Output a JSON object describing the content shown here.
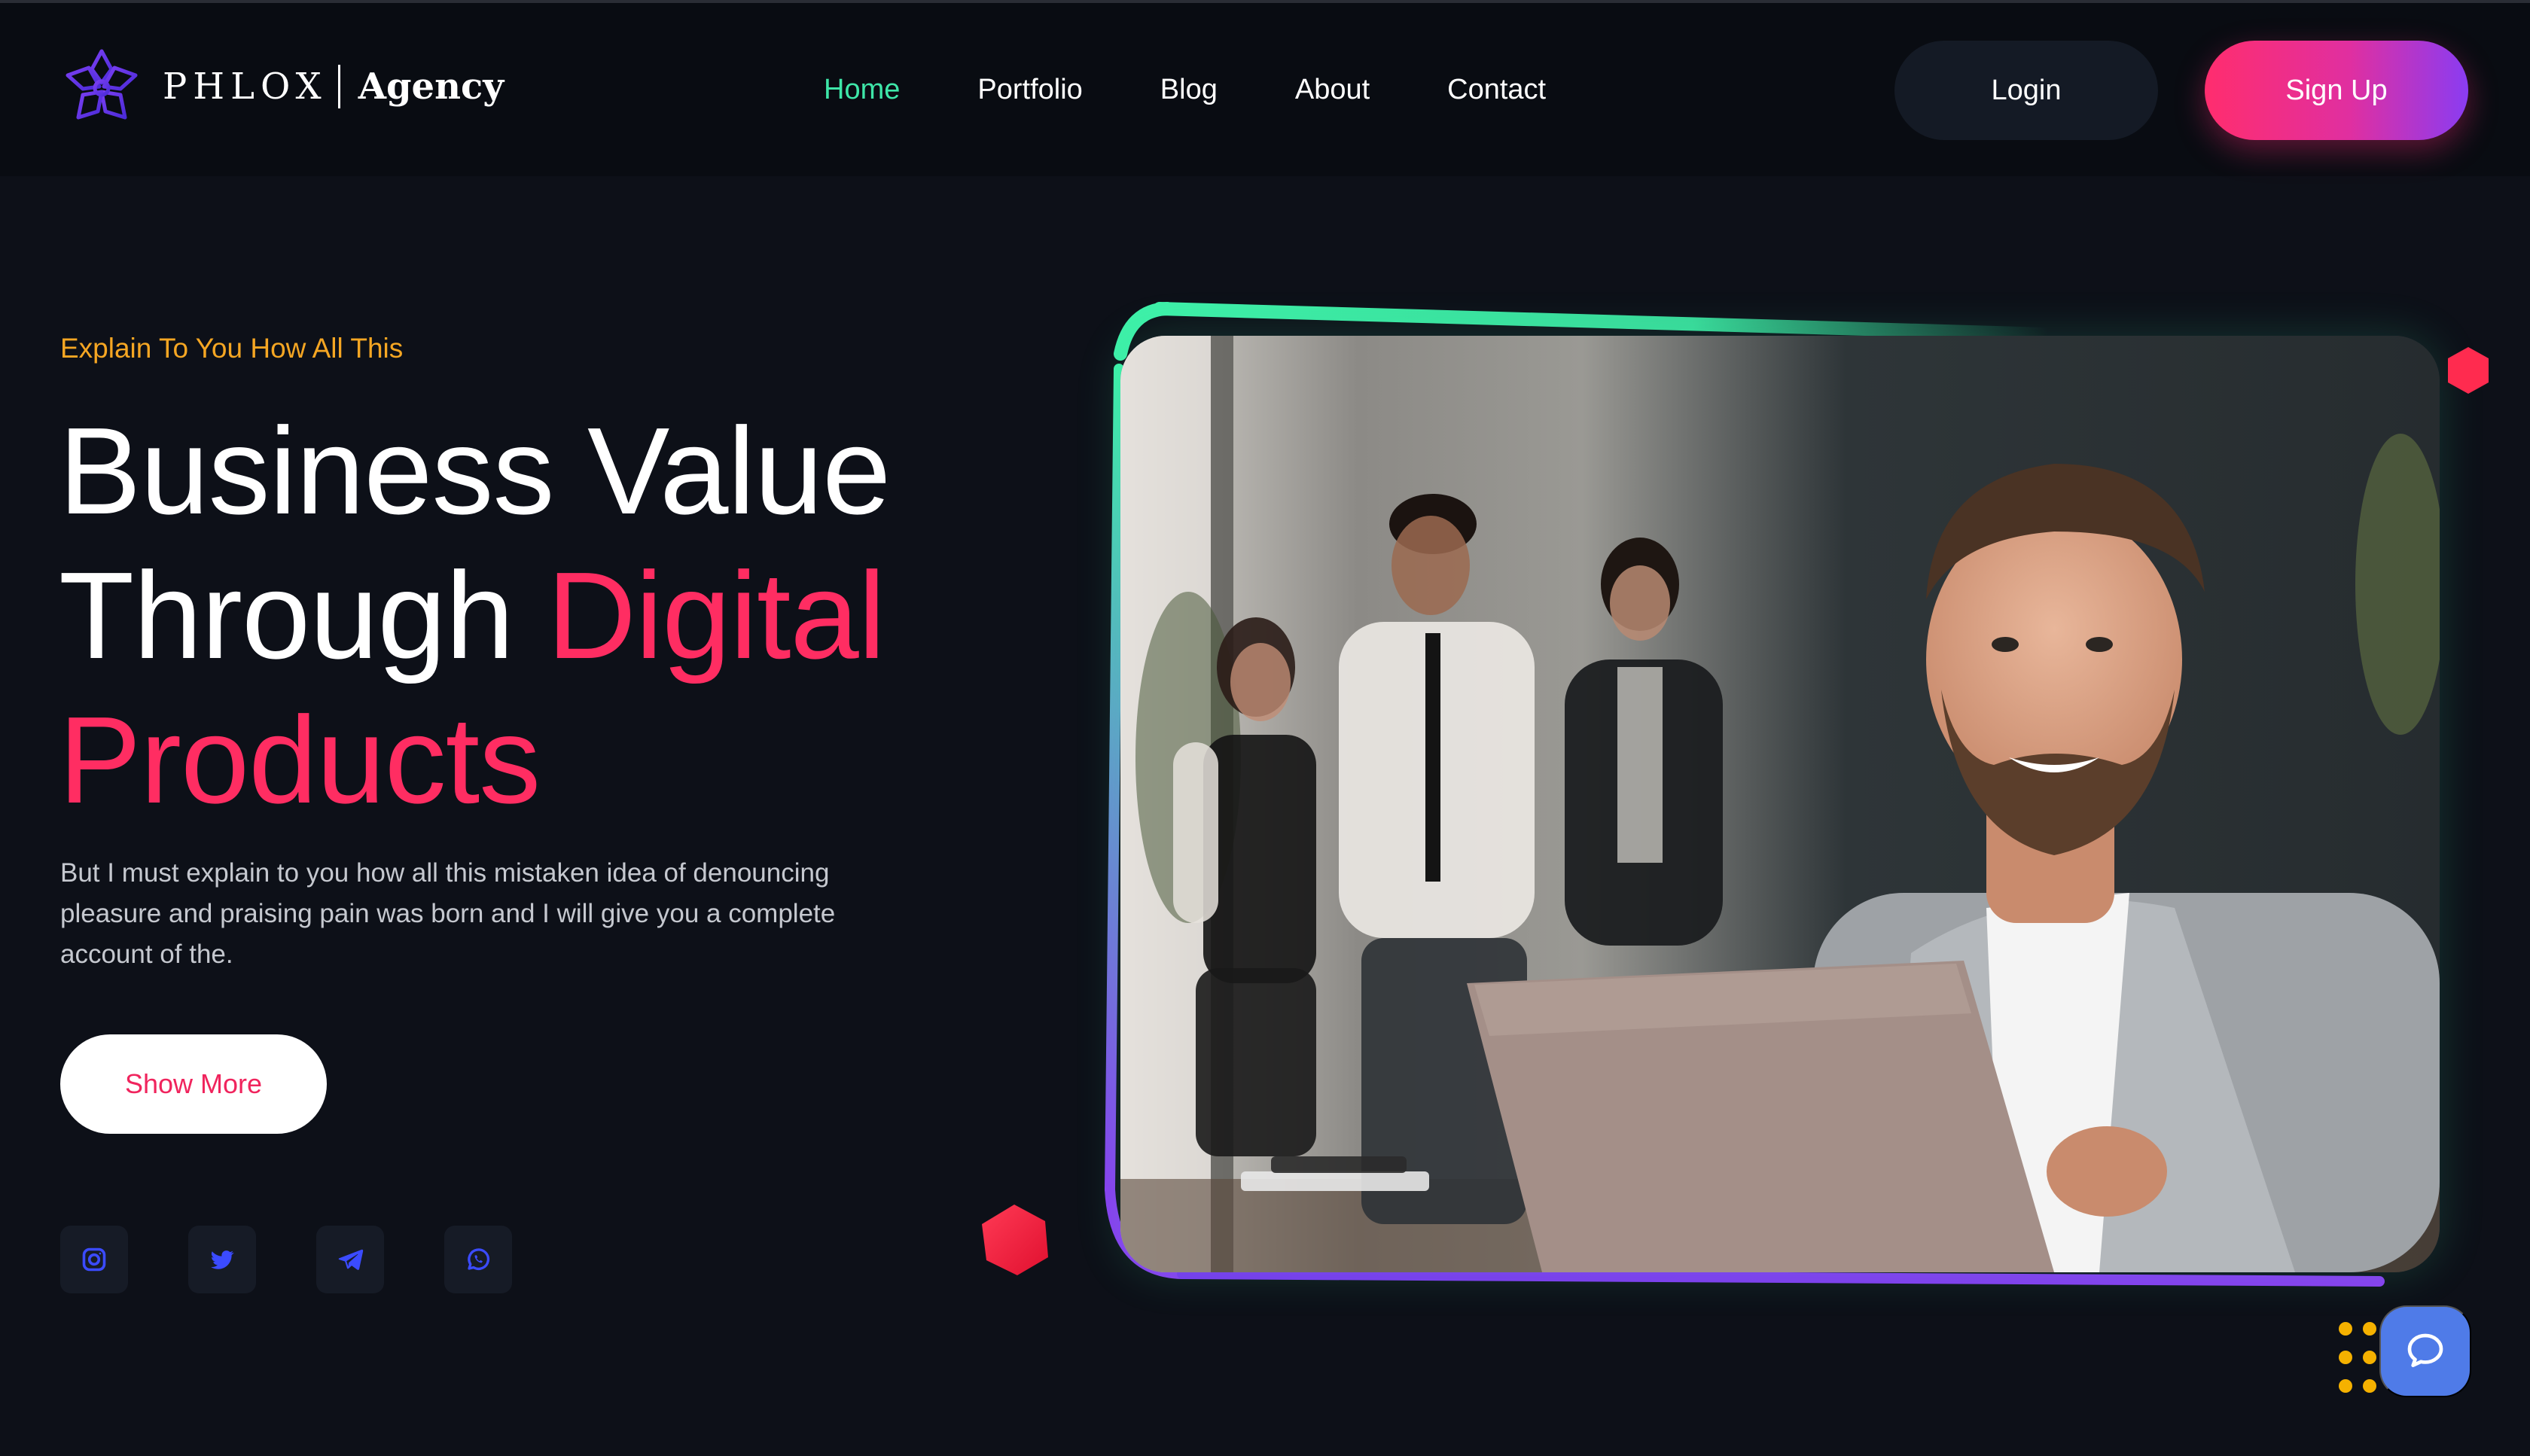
{
  "brand": {
    "name": "PHLOX",
    "suffix": "Agency",
    "icon": "flower-logo-icon"
  },
  "nav": {
    "items": [
      {
        "label": "Home",
        "active": true
      },
      {
        "label": "Portfolio",
        "active": false
      },
      {
        "label": "Blog",
        "active": false
      },
      {
        "label": "About",
        "active": false
      },
      {
        "label": "Contact",
        "active": false
      }
    ],
    "login_label": "Login",
    "signup_label": "Sign Up"
  },
  "hero": {
    "eyebrow": "Explain To You How All This",
    "headline_line1": "Business Value",
    "headline_line2_plain": "Through ",
    "headline_line2_accent": "Digital",
    "headline_line3_accent": "Products",
    "description": "But I must explain to you how all this mistaken idea of denouncing pleasure and praising pain was born and I will give you a complete account of the.",
    "cta_label": "Show More",
    "image_alt": "Smiling man with laptop in office, colleagues in background"
  },
  "socials": [
    {
      "name": "instagram-icon"
    },
    {
      "name": "twitter-icon"
    },
    {
      "name": "telegram-icon"
    },
    {
      "name": "whatsapp-icon"
    }
  ],
  "chat": {
    "icon": "chat-bubble-icon"
  },
  "colors": {
    "background": "#0d1018",
    "navbar": "#090c12",
    "accent_green": "#3ee6a8",
    "accent_pink": "#ff2d62",
    "eyebrow_orange": "#f5a623",
    "social_icon_blue": "#3b4bff",
    "chat_blue": "#4f7be8",
    "signup_gradient_start": "#ff2d6e",
    "signup_gradient_end": "#8a3cf2"
  }
}
